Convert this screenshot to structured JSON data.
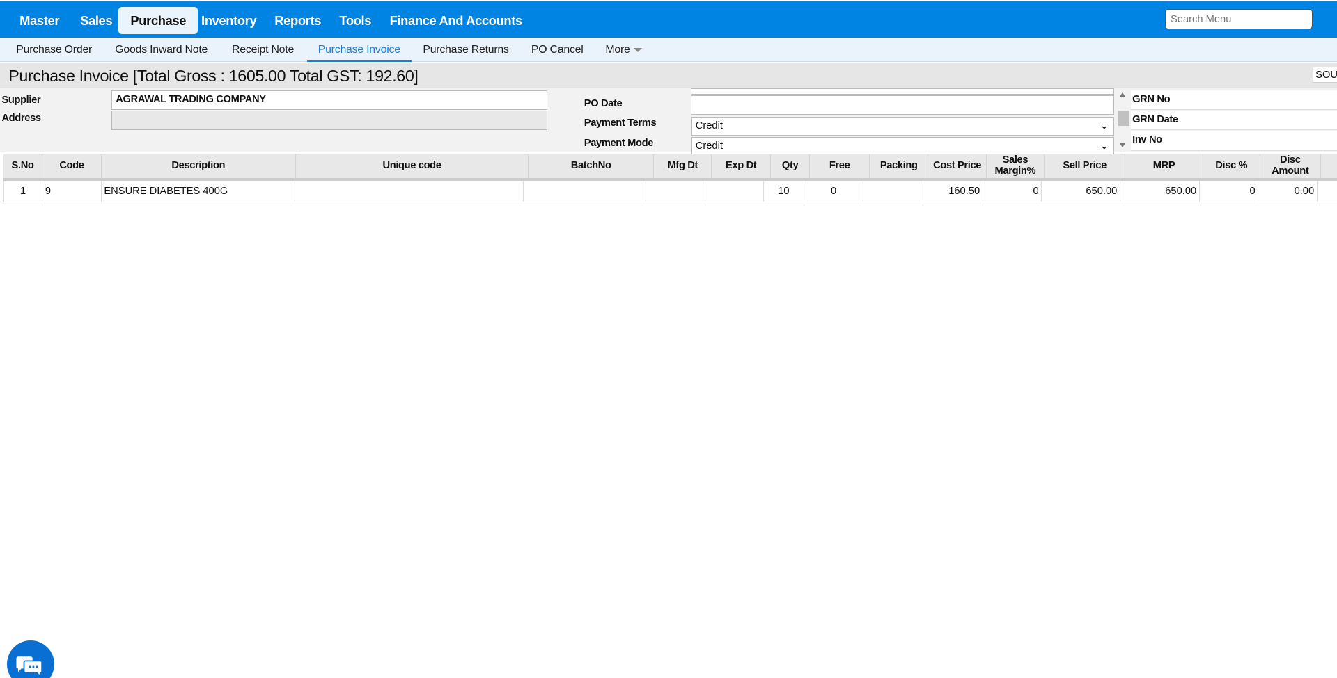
{
  "topnav": {
    "items": [
      "Master",
      "Sales",
      "Purchase",
      "Inventory",
      "Reports",
      "Tools",
      "Finance And Accounts"
    ],
    "active": "Purchase",
    "search_placeholder": "Search Menu"
  },
  "subnav": {
    "items": [
      "Purchase Order",
      "Goods Inward Note",
      "Receipt Note",
      "Purchase Invoice",
      "Purchase Returns",
      "PO Cancel",
      "More"
    ],
    "active": "Purchase Invoice"
  },
  "title": "Purchase Invoice [Total Gross : 1605.00 Total GST: 192.60]",
  "sou": "SOU",
  "form": {
    "supplier_label": "Supplier",
    "supplier_value": "AGRAWAL TRADING COMPANY",
    "address_label": "Address",
    "address_value": "",
    "po_date_label": "PO Date",
    "po_date_value": "",
    "payment_terms_label": "Payment Terms",
    "payment_terms_value": "Credit",
    "payment_mode_label": "Payment Mode",
    "payment_mode_value": "Credit",
    "grn_no_label": "GRN No",
    "grn_date_label": "GRN Date",
    "inv_no_label": "Inv No"
  },
  "table": {
    "headers": [
      "S.No",
      "Code",
      "Description",
      "Unique code",
      "BatchNo",
      "Mfg Dt",
      "Exp Dt",
      "Qty",
      "Free",
      "Packing",
      "Cost Price",
      "Sales Margin%",
      "Sell Price",
      "MRP",
      "Disc %",
      "Disc Amount"
    ],
    "rows": [
      [
        "1",
        "9",
        "ENSURE DIABETES 400G",
        "",
        "",
        "",
        "",
        "10",
        "0",
        "",
        "160.50",
        "0",
        "650.00",
        "650.00",
        "0",
        "0.00"
      ]
    ]
  },
  "colors": {
    "topbar": "#0084e4",
    "accent": "#1a7fd4",
    "chat": "#0a6fd2"
  }
}
